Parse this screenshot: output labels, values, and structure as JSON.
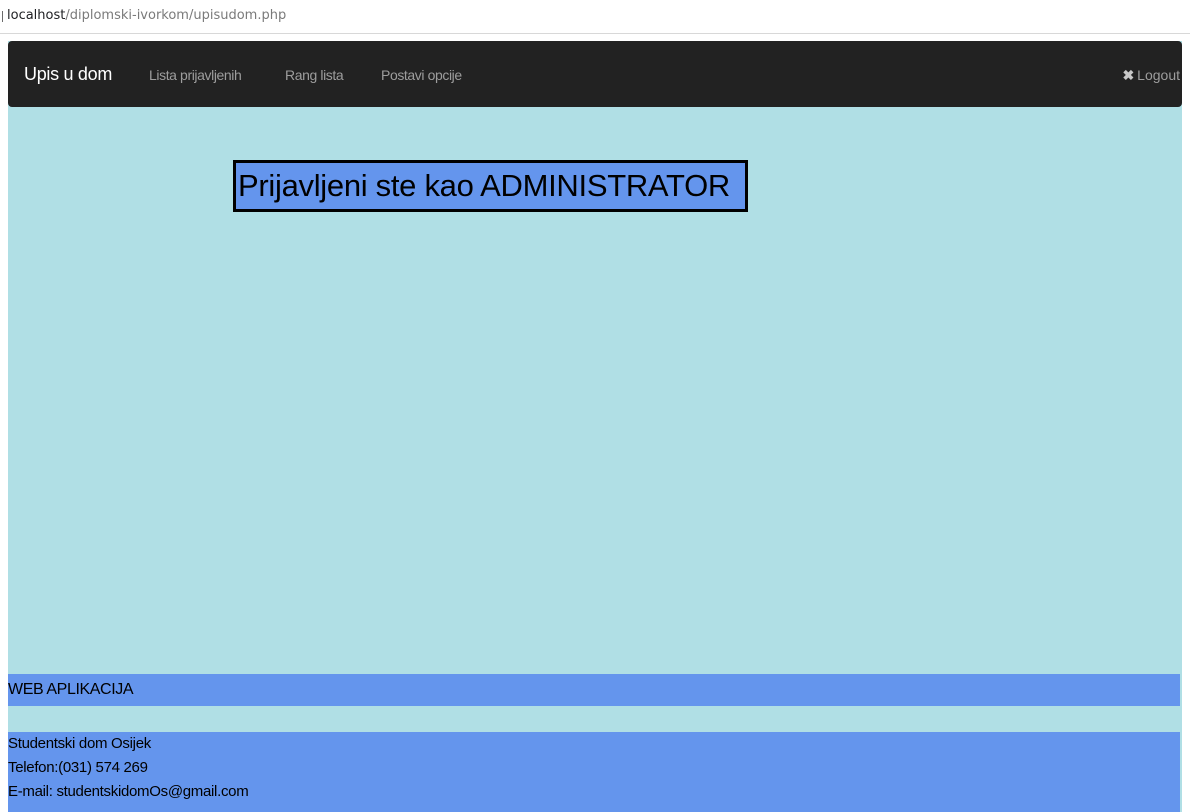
{
  "browser": {
    "url_host": "localhost",
    "url_path": "/diplomski-ivorkom/upisudom.php"
  },
  "navbar": {
    "brand": "Upis u dom",
    "links": [
      "Lista prijavljenih",
      "Rang lista",
      "Postavi opcije"
    ],
    "logout_icon": "close-icon",
    "logout_label": "Logout"
  },
  "main": {
    "banner": "Prijavljeni ste kao ADMINISTRATOR"
  },
  "footer": {
    "heading": "WEB APLIKACIJA",
    "contact_lines": [
      "Studentski dom Osijek",
      "Telefon:(031) 574 269",
      "E-mail: studentskidomOs@gmail.com"
    ]
  },
  "colors": {
    "navbar_bg": "#222222",
    "page_bg": "#b0dfe5",
    "accent_blue": "#6495ed",
    "nav_link": "#9d9d9d"
  }
}
